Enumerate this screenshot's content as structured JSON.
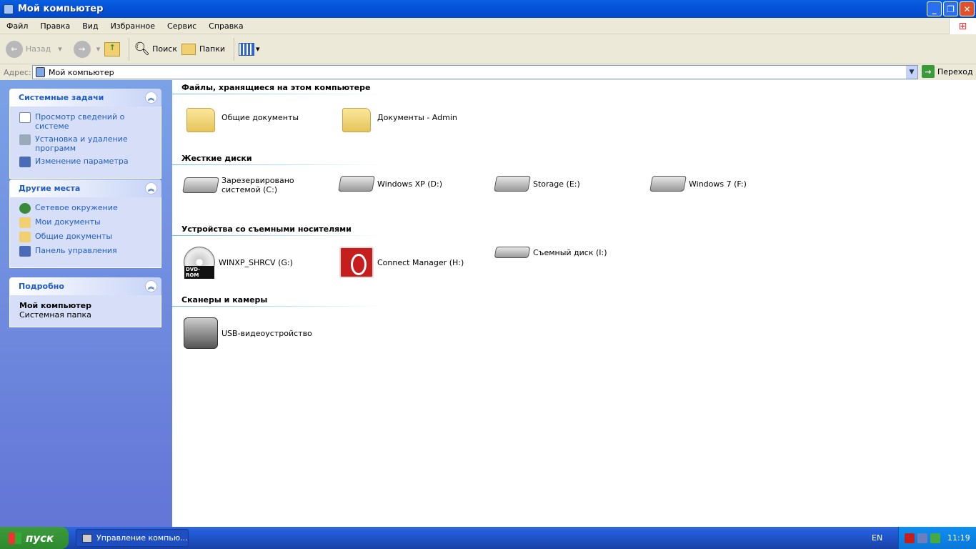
{
  "window": {
    "title": "Мой компьютер",
    "minimize": "_",
    "maximize": "❐",
    "close": "✕"
  },
  "menu": [
    "Файл",
    "Правка",
    "Вид",
    "Избранное",
    "Сервис",
    "Справка"
  ],
  "toolbar": {
    "back": "Назад",
    "search": "Поиск",
    "folders": "Папки"
  },
  "address": {
    "label": "Адрес:",
    "value": "Мой компьютер",
    "go": "Переход"
  },
  "sidebar": {
    "system_tasks": {
      "title": "Системные задачи",
      "items": [
        "Просмотр сведений о системе",
        "Установка и удаление программ",
        "Изменение параметра"
      ]
    },
    "other_places": {
      "title": "Другие места",
      "items": [
        "Сетевое окружение",
        "Мои документы",
        "Общие документы",
        "Панель управления"
      ]
    },
    "details": {
      "title": "Подробно",
      "name": "Мой компьютер",
      "type": "Системная папка"
    }
  },
  "groups": [
    {
      "title": "Файлы, хранящиеся на этом компьютере",
      "items": [
        "Общие документы",
        "Документы - Admin"
      ]
    },
    {
      "title": "Жесткие диски",
      "items": [
        "Зарезервировано системой (C:)",
        "Windows XP (D:)",
        "Storage (E:)",
        "Windows 7 (F:)"
      ]
    },
    {
      "title": "Устройства со съемными носителями",
      "items": [
        "WINXP_SHRCV (G:)",
        "Connect Manager (H:)",
        "Съемный диск (I:)"
      ],
      "dvd_label": "DVD-ROM"
    },
    {
      "title": "Сканеры и камеры",
      "items": [
        "USB-видеоустройство"
      ]
    }
  ],
  "taskbar": {
    "start": "пуск",
    "task": "Управление компью...",
    "lang": "EN",
    "clock": "11:19"
  }
}
